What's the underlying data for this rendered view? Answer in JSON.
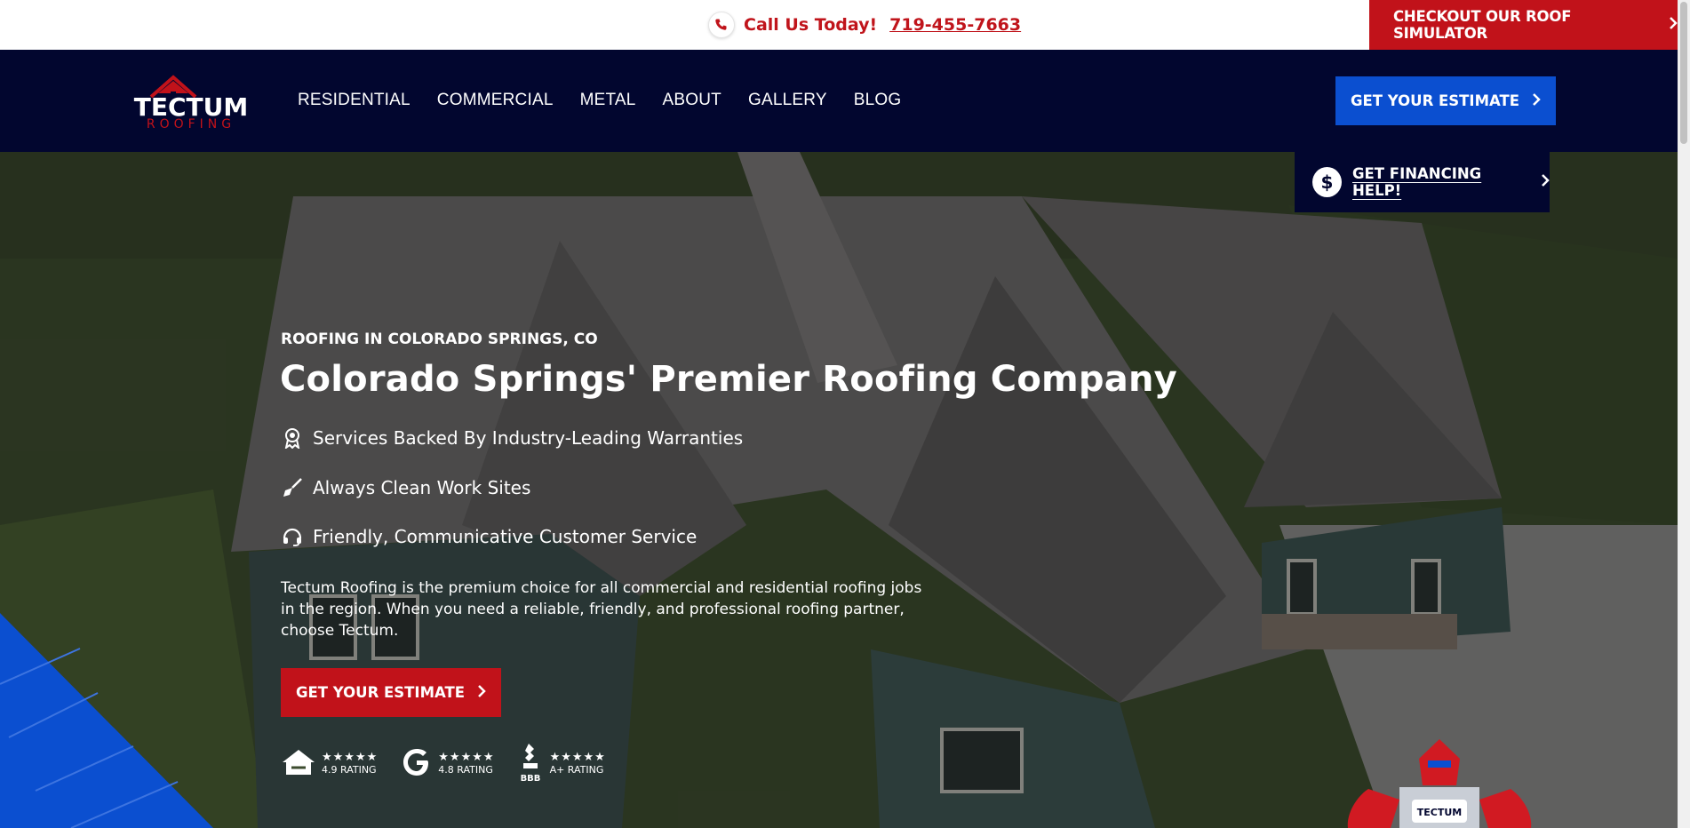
{
  "topbar": {
    "call_label": "Call Us Today!",
    "phone": "719-455-7663",
    "simulator_label": "CHECKOUT OUR ROOF SIMULATOR"
  },
  "brand": {
    "name_top": "TECTUM",
    "name_bottom": "ROOFING",
    "colors": {
      "navy": "#02062f",
      "red": "#c1121a",
      "blue": "#0b4fd0"
    }
  },
  "nav": {
    "items": [
      "RESIDENTIAL",
      "COMMERCIAL",
      "METAL",
      "ABOUT",
      "GALLERY",
      "BLOG"
    ],
    "estimate_label": "GET YOUR ESTIMATE"
  },
  "financing": {
    "label": "GET FINANCING HELP!"
  },
  "hero": {
    "eyebrow": "ROOFING IN COLORADO SPRINGS, CO",
    "headline": "Colorado Springs' Premier Roofing Company",
    "features": [
      {
        "icon": "award-ribbon-icon",
        "text": "Services Backed By Industry-Leading Warranties"
      },
      {
        "icon": "broom-icon",
        "text": "Always Clean Work Sites"
      },
      {
        "icon": "headset-icon",
        "text": "Friendly, Communicative Customer Service"
      }
    ],
    "description": "Tectum Roofing is the premium choice for all commercial and residential roofing jobs in the region. When you need a reliable, friendly, and professional roofing partner, choose Tectum.",
    "estimate_label": "GET YOUR ESTIMATE"
  },
  "ratings": [
    {
      "icon": "home-review-icon",
      "stars": "★★★★★",
      "text": "4.9 RATING"
    },
    {
      "icon": "google-icon",
      "stars": "★★★★★",
      "text": "4.8 RATING"
    },
    {
      "icon": "bbb-icon",
      "stars": "★★★★★",
      "text": "A+ RATING"
    }
  ]
}
